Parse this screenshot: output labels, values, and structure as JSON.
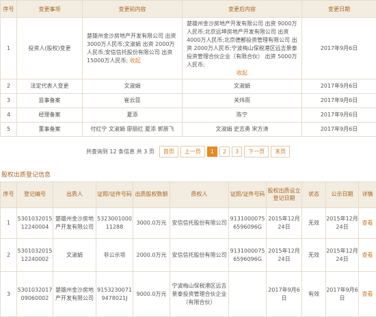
{
  "changes": {
    "headers": [
      "序号",
      "变更事项",
      "变更前内容",
      "变更后内容",
      "变更日期"
    ],
    "rows": [
      {
        "no": "1",
        "item": "投资人(股权)变更",
        "before": "楚雄州金沙房地产开发有限公司 出资 3000万人民币;文淑娟 出资 2000万人民币;安信信托股份有限公司 出资 15000万人民币;",
        "before_toggle": "收起",
        "after": "楚雄州金沙房地产开发有限公司 出资 9000万人民币;北京远坤房地产开发有限公司 出资 4000万人民币;北京德鄯投资管理有限公司 出资 2000万人民币;宁波梅山保税港区远吉景泰投资管理合伙企业（有限合伙） 出资 5000万人民币;",
        "after_toggle": "收起",
        "date": "2017年9月6日"
      },
      {
        "no": "2",
        "item": "法定代表人变更",
        "before": "文淑娟",
        "after": "文淑娟",
        "date": "2017年9月6日"
      },
      {
        "no": "3",
        "item": "监事备案",
        "before": "崔云昆",
        "after": "关炜雨",
        "date": "2017年9月6日"
      },
      {
        "no": "4",
        "item": "经理备案",
        "before": "夏添",
        "after": "陈宁",
        "date": "2017年9月6日"
      },
      {
        "no": "5",
        "item": "董事备案",
        "before": "付红宁 文淑娟 廖丽红 夏添 郭辰飞",
        "after": "文淑娟 史志勇 宋方涛",
        "date": "2017年9月6日"
      }
    ]
  },
  "pager": {
    "info": "共查询到 12 条信息 共 3 页",
    "first": "首页",
    "prev": "上一页",
    "pages": [
      "1",
      "2",
      "3"
    ],
    "current": "1",
    "next": "下一页",
    "last": "末页"
  },
  "pledge": {
    "title": "股权出质登记信息",
    "headers": [
      "序号",
      "登记编号",
      "出质人",
      "证照/证件号码",
      "出质股权数额",
      "质权人",
      "证照/证件号码",
      "股权出质设立登记日期",
      "状态",
      "公示日期",
      "详情"
    ],
    "rows": [
      {
        "no": "1",
        "reg_no": "530103201512240004",
        "pledgor": "楚雄州金沙房地产开发有限公司",
        "pledgor_id": "532300100011288",
        "amount": "3000.0万元",
        "pledgee": "安信信托股份有限公司",
        "pledgee_id": "91310000756596096G",
        "reg_date": "2015年12月24日",
        "status": "无效",
        "pub_date": "2015年12月24日",
        "detail": "查看"
      },
      {
        "no": "2",
        "reg_no": "530103201512240002",
        "pledgor": "文淑娟",
        "pledgor_id": "非公示项",
        "amount": "2000.0万元",
        "pledgee": "安信信托股份有限公司",
        "pledgee_id": "91310000756596096G",
        "reg_date": "2015年12月24日",
        "status": "无效",
        "pub_date": "2015年12月24日",
        "detail": "查看"
      },
      {
        "no": "3",
        "reg_no": "530103201709060002",
        "pledgor": "楚雄州金沙房地产开发有限公司",
        "pledgor_id": "91532300719478021J",
        "amount": "9000.0万元",
        "pledgee": "宁波梅山保税港区远吉景泰投资管理合伙企业（有限合伙）",
        "pledgee_id": "",
        "reg_date": "2017年9月6日",
        "status": "有效",
        "pub_date": "2017年9月6日",
        "detail": "查看"
      }
    ]
  }
}
